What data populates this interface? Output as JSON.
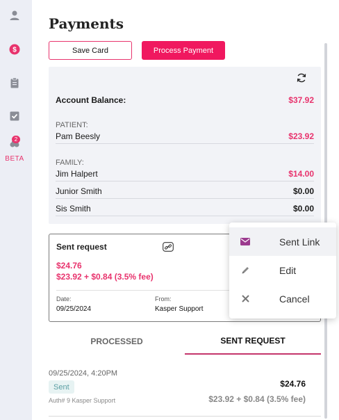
{
  "sidebar": {
    "items": [
      {
        "icon": "person-icon"
      },
      {
        "icon": "dollar-icon"
      },
      {
        "icon": "clipboard-icon"
      },
      {
        "icon": "checkbox-icon"
      },
      {
        "icon": "beta-icon",
        "badge": "2",
        "label": "BETA"
      }
    ]
  },
  "page": {
    "title": "Payments"
  },
  "actions": {
    "save_card": "Save Card",
    "process_payment": "Process Payment"
  },
  "balance": {
    "account_label": "Account Balance:",
    "account_value": "$37.92",
    "patient_section": "PATIENT:",
    "patient_name": "Pam Beesly",
    "patient_value": "$23.92",
    "family_section": "FAMILY:",
    "family": [
      {
        "name": "Jim Halpert",
        "value": "$14.00"
      },
      {
        "name": "Junior Smith",
        "value": "$0.00"
      },
      {
        "name": "Sis Smith",
        "value": "$0.00"
      }
    ]
  },
  "request": {
    "title": "Sent request",
    "amount": "$24.76",
    "breakdown": "$23.92 + $0.84 (3.5% fee)",
    "date_label": "Date:",
    "date_value": "09/25/2024",
    "from_label": "From:",
    "from_value": "Kasper Support"
  },
  "menu": {
    "items": [
      "Sent Link",
      "Edit",
      "Cancel"
    ]
  },
  "tabs": {
    "processed": "PROCESSED",
    "sent": "SENT REQUEST"
  },
  "transaction": {
    "date": "09/25/2024, 4:20PM",
    "status": "Sent",
    "auth": "Auth# 9 Kasper Support",
    "amount": "$24.76",
    "breakdown": "$23.92 + $0.84 (3.5% fee)"
  },
  "colors": {
    "accent": "#e8336d",
    "primary_button": "#f0185f",
    "rail": "#eceef5"
  }
}
